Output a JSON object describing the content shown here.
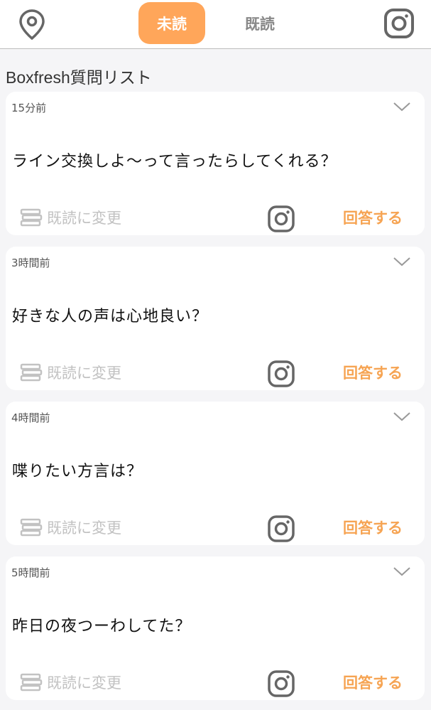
{
  "header": {
    "tabs": [
      {
        "label": "未読",
        "active": true
      },
      {
        "label": "既読",
        "active": false
      }
    ],
    "location_icon": "map-pin-icon",
    "instagram_icon": "instagram-icon"
  },
  "list": {
    "title": "Boxfresh質問リスト"
  },
  "cards": [
    {
      "time": "15分前",
      "question": "ライン交換しよ〜って言ったらしてくれる？",
      "mark_read_label": "既読に変更",
      "answer_label": "回答する"
    },
    {
      "time": "3時間前",
      "question": "好きな人の声は心地良い？",
      "mark_read_label": "既読に変更",
      "answer_label": "回答する"
    },
    {
      "time": "4時間前",
      "question": "喋りたい方言は？",
      "mark_read_label": "既読に変更",
      "answer_label": "回答する"
    },
    {
      "time": "5時間前",
      "question": "昨日の夜つーわしてた？",
      "mark_read_label": "既読に変更",
      "answer_label": "回答する"
    }
  ],
  "colors": {
    "accent": "#ffa65a",
    "answer": "#f6a453",
    "muted": "#c2c2c2",
    "icon_gray": "#666666"
  }
}
